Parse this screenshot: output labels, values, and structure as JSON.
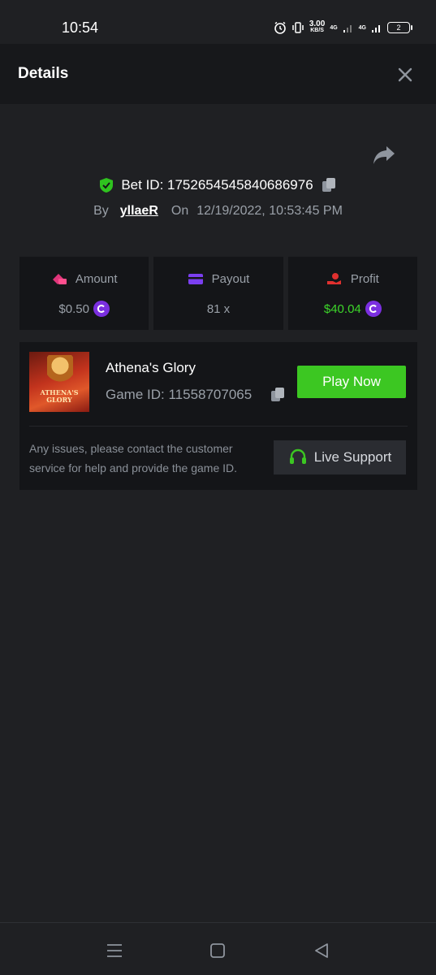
{
  "status_bar": {
    "time": "10:54",
    "net_speed_value": "3.00",
    "net_speed_unit": "KB/S",
    "network_1": "4G",
    "network_2": "4G",
    "battery": "2"
  },
  "header": {
    "title": "Details"
  },
  "bet": {
    "id_label": "Bet ID: 1752654545840686976",
    "by_label": "By",
    "user": "yllaeR",
    "on_label": "On",
    "datetime": "12/19/2022, 10:53:45 PM"
  },
  "stats": {
    "amount_label": "Amount",
    "amount_value": "$0.50",
    "payout_label": "Payout",
    "payout_value": "81 x",
    "profit_label": "Profit",
    "profit_value": "$40.04"
  },
  "game": {
    "name": "Athena's Glory",
    "id_label": "Game ID: 11558707065",
    "thumb_text_1": "ATHENA'S",
    "thumb_text_2": "GLORY",
    "play_label": "Play Now",
    "help_text": "Any issues, please contact the customer service for help and provide the game ID.",
    "support_label": "Live Support"
  },
  "colors": {
    "background": "#1f2023",
    "card": "#141518",
    "accent_green": "#3cc722",
    "profit_green": "#3dd62a",
    "coin_purple": "#7b2fe0"
  }
}
